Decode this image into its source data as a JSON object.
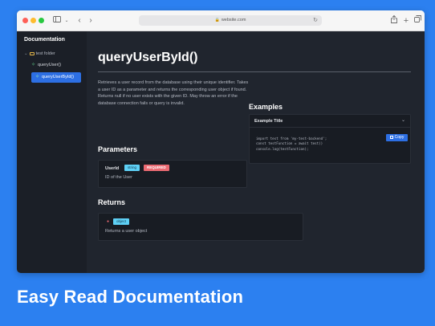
{
  "browser": {
    "url": "website.com",
    "icons": {
      "sidebar_toggle": "sidebar-icon",
      "back": "chevron-left-icon",
      "forward": "chevron-right-icon",
      "share": "share-icon",
      "new_tab": "plus-icon",
      "tabs": "tabs-icon"
    }
  },
  "sidebar": {
    "title": "Documentation",
    "folder": "test folder",
    "items": [
      {
        "label": "queryUser()",
        "active": false
      },
      {
        "label": "queryUserById()",
        "active": true
      }
    ]
  },
  "main": {
    "title": "queryUserById()",
    "description": "Retrieves a user record from the database using their unique identifier. Takes a user ID as a parameter and returns the corresponding user object if found. Returns null if no user exists with the given ID. May throw an error if the database connection fails or query is invalid.",
    "parameters": {
      "heading": "Parameters",
      "items": [
        {
          "name": "UserId",
          "type": "string",
          "required": "REQUIRED",
          "description": "ID of the User"
        }
      ]
    },
    "returns": {
      "heading": "Returns",
      "type": "object",
      "description": "Returns a user object"
    },
    "examples": {
      "heading": "Examples",
      "items": [
        {
          "title": "Example Title",
          "copy_label": "Copy",
          "code": "import test from 'my-test-backend';\nconst testFunction = await test()\nconsole.log(testFunction);"
        }
      ]
    }
  },
  "footer": {
    "title": "Easy Read Documentation"
  },
  "colors": {
    "background": "#2c80f0",
    "accent": "#2d6fe3",
    "string_badge": "#5ed0f5",
    "required_badge": "#ea6a72"
  }
}
